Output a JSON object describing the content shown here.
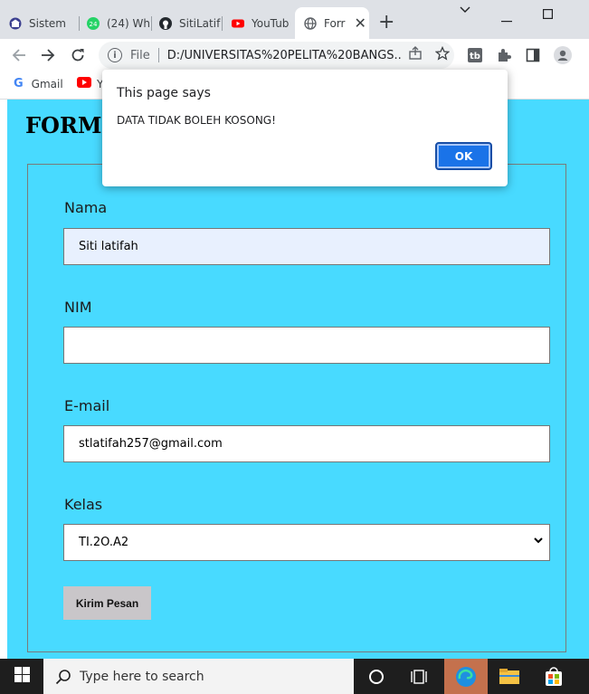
{
  "browser": {
    "tabs": [
      {
        "label": "Sistem",
        "icon": "university-icon"
      },
      {
        "label": "(24) Wh",
        "icon": "whatsapp-icon",
        "badge": "24"
      },
      {
        "label": "SitiLatif",
        "icon": "github-icon"
      },
      {
        "label": "YouTub",
        "icon": "youtube-icon"
      },
      {
        "label": "Forr",
        "icon": "globe-icon",
        "active": true
      }
    ],
    "new_tab": "+",
    "address": {
      "scheme": "File",
      "url": "D:/UNIVERSITAS%20PELITA%20BANGS..."
    },
    "bookmarks": [
      {
        "label": "Gmail",
        "icon": "google-icon"
      },
      {
        "label": "Y",
        "icon": "youtube-icon"
      }
    ]
  },
  "page": {
    "title": "FORM V",
    "fields": {
      "nama": {
        "label": "Nama",
        "value": "Siti latifah"
      },
      "nim": {
        "label": "NIM",
        "value": ""
      },
      "email": {
        "label": "E-mail",
        "value": "stlatifah257@gmail.com"
      },
      "kelas": {
        "label": "Kelas",
        "value": "TI.2O.A2"
      }
    },
    "submit_label": "Kirim Pesan"
  },
  "dialog": {
    "title": "This page says",
    "message": "DATA TIDAK BOLEH KOSONG!",
    "ok_label": "OK"
  },
  "taskbar": {
    "search_placeholder": "Type here to search"
  },
  "colors": {
    "page_bg": "#48daff",
    "autofill_bg": "#e8f0fe",
    "ok_button": "#1a73e8",
    "submit_button": "#c9c6c9"
  }
}
